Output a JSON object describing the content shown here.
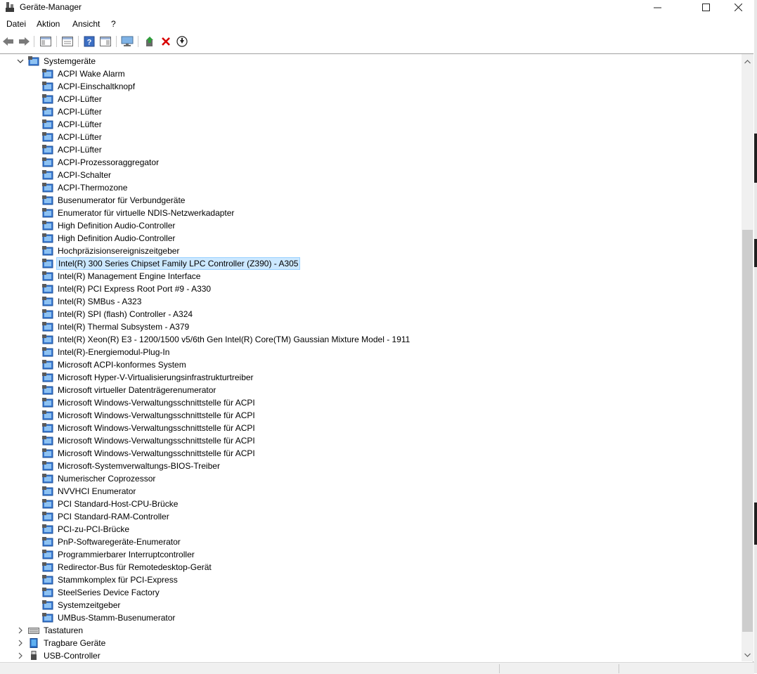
{
  "window": {
    "title": "Geräte-Manager",
    "controls": {
      "minimize": "—",
      "maximize": "☐",
      "close": "✕"
    }
  },
  "menu": [
    "Datei",
    "Aktion",
    "Ansicht",
    "?"
  ],
  "toolbar": {
    "icons": [
      "back-arrow-icon",
      "forward-arrow-icon",
      "show-hide-console-tree-icon",
      "properties-icon",
      "help-icon",
      "action-pane-icon",
      "monitor-scan-icon",
      "update-driver-icon",
      "uninstall-device-icon",
      "enable-device-icon"
    ],
    "colors": {
      "update": "#2e9b3a",
      "uninstall": "#d80000"
    }
  },
  "tree": {
    "category_expanded": {
      "label": "Systemgeräte",
      "expander": "⌄"
    },
    "selected_index": 15,
    "selection_color": "#cce8ff",
    "devices": [
      "ACPI Wake Alarm",
      "ACPI-Einschaltknopf",
      "ACPI-Lüfter",
      "ACPI-Lüfter",
      "ACPI-Lüfter",
      "ACPI-Lüfter",
      "ACPI-Lüfter",
      "ACPI-Prozessoraggregator",
      "ACPI-Schalter",
      "ACPI-Thermozone",
      "Busenumerator für Verbundgeräte",
      "Enumerator für virtuelle NDIS-Netzwerkadapter",
      "High Definition Audio-Controller",
      "High Definition Audio-Controller",
      "Hochpräzisionsereigniszeitgeber",
      "Intel(R) 300 Series Chipset Family LPC Controller (Z390) - A305",
      "Intel(R) Management Engine Interface",
      "Intel(R) PCI Express Root Port #9 - A330",
      "Intel(R) SMBus - A323",
      "Intel(R) SPI (flash) Controller - A324",
      "Intel(R) Thermal Subsystem - A379",
      "Intel(R) Xeon(R) E3 - 1200/1500 v5/6th Gen Intel(R) Core(TM) Gaussian Mixture Model - 1911",
      "Intel(R)-Energiemodul-Plug-In",
      "Microsoft ACPI-konformes System",
      "Microsoft Hyper-V-Virtualisierungsinfrastrukturtreiber",
      "Microsoft virtueller Datenträgerenumerator",
      "Microsoft Windows-Verwaltungsschnittstelle für ACPI",
      "Microsoft Windows-Verwaltungsschnittstelle für ACPI",
      "Microsoft Windows-Verwaltungsschnittstelle für ACPI",
      "Microsoft Windows-Verwaltungsschnittstelle für ACPI",
      "Microsoft Windows-Verwaltungsschnittstelle für ACPI",
      "Microsoft-Systemverwaltungs-BIOS-Treiber",
      "Numerischer Coprozessor",
      "NVVHCI Enumerator",
      "PCI Standard-Host-CPU-Brücke",
      "PCI Standard-RAM-Controller",
      "PCI-zu-PCI-Brücke",
      "PnP-Softwaregeräte-Enumerator",
      "Programmierbarer Interruptcontroller",
      "Redirector-Bus für Remotedesktop-Gerät",
      "Stammkomplex für PCI-Express",
      "SteelSeries Device Factory",
      "Systemzeitgeber",
      "UMBus-Stamm-Busenumerator"
    ],
    "categories_collapsed": [
      {
        "label": "Tastaturen",
        "icon": "keyboard-icon",
        "expander": "›"
      },
      {
        "label": "Tragbare Geräte",
        "icon": "portable-device-icon",
        "expander": "›"
      },
      {
        "label": "USB-Controller",
        "icon": "usb-icon",
        "expander": "›"
      }
    ]
  },
  "scrollbar": {
    "up": "▲",
    "down": "▼"
  }
}
